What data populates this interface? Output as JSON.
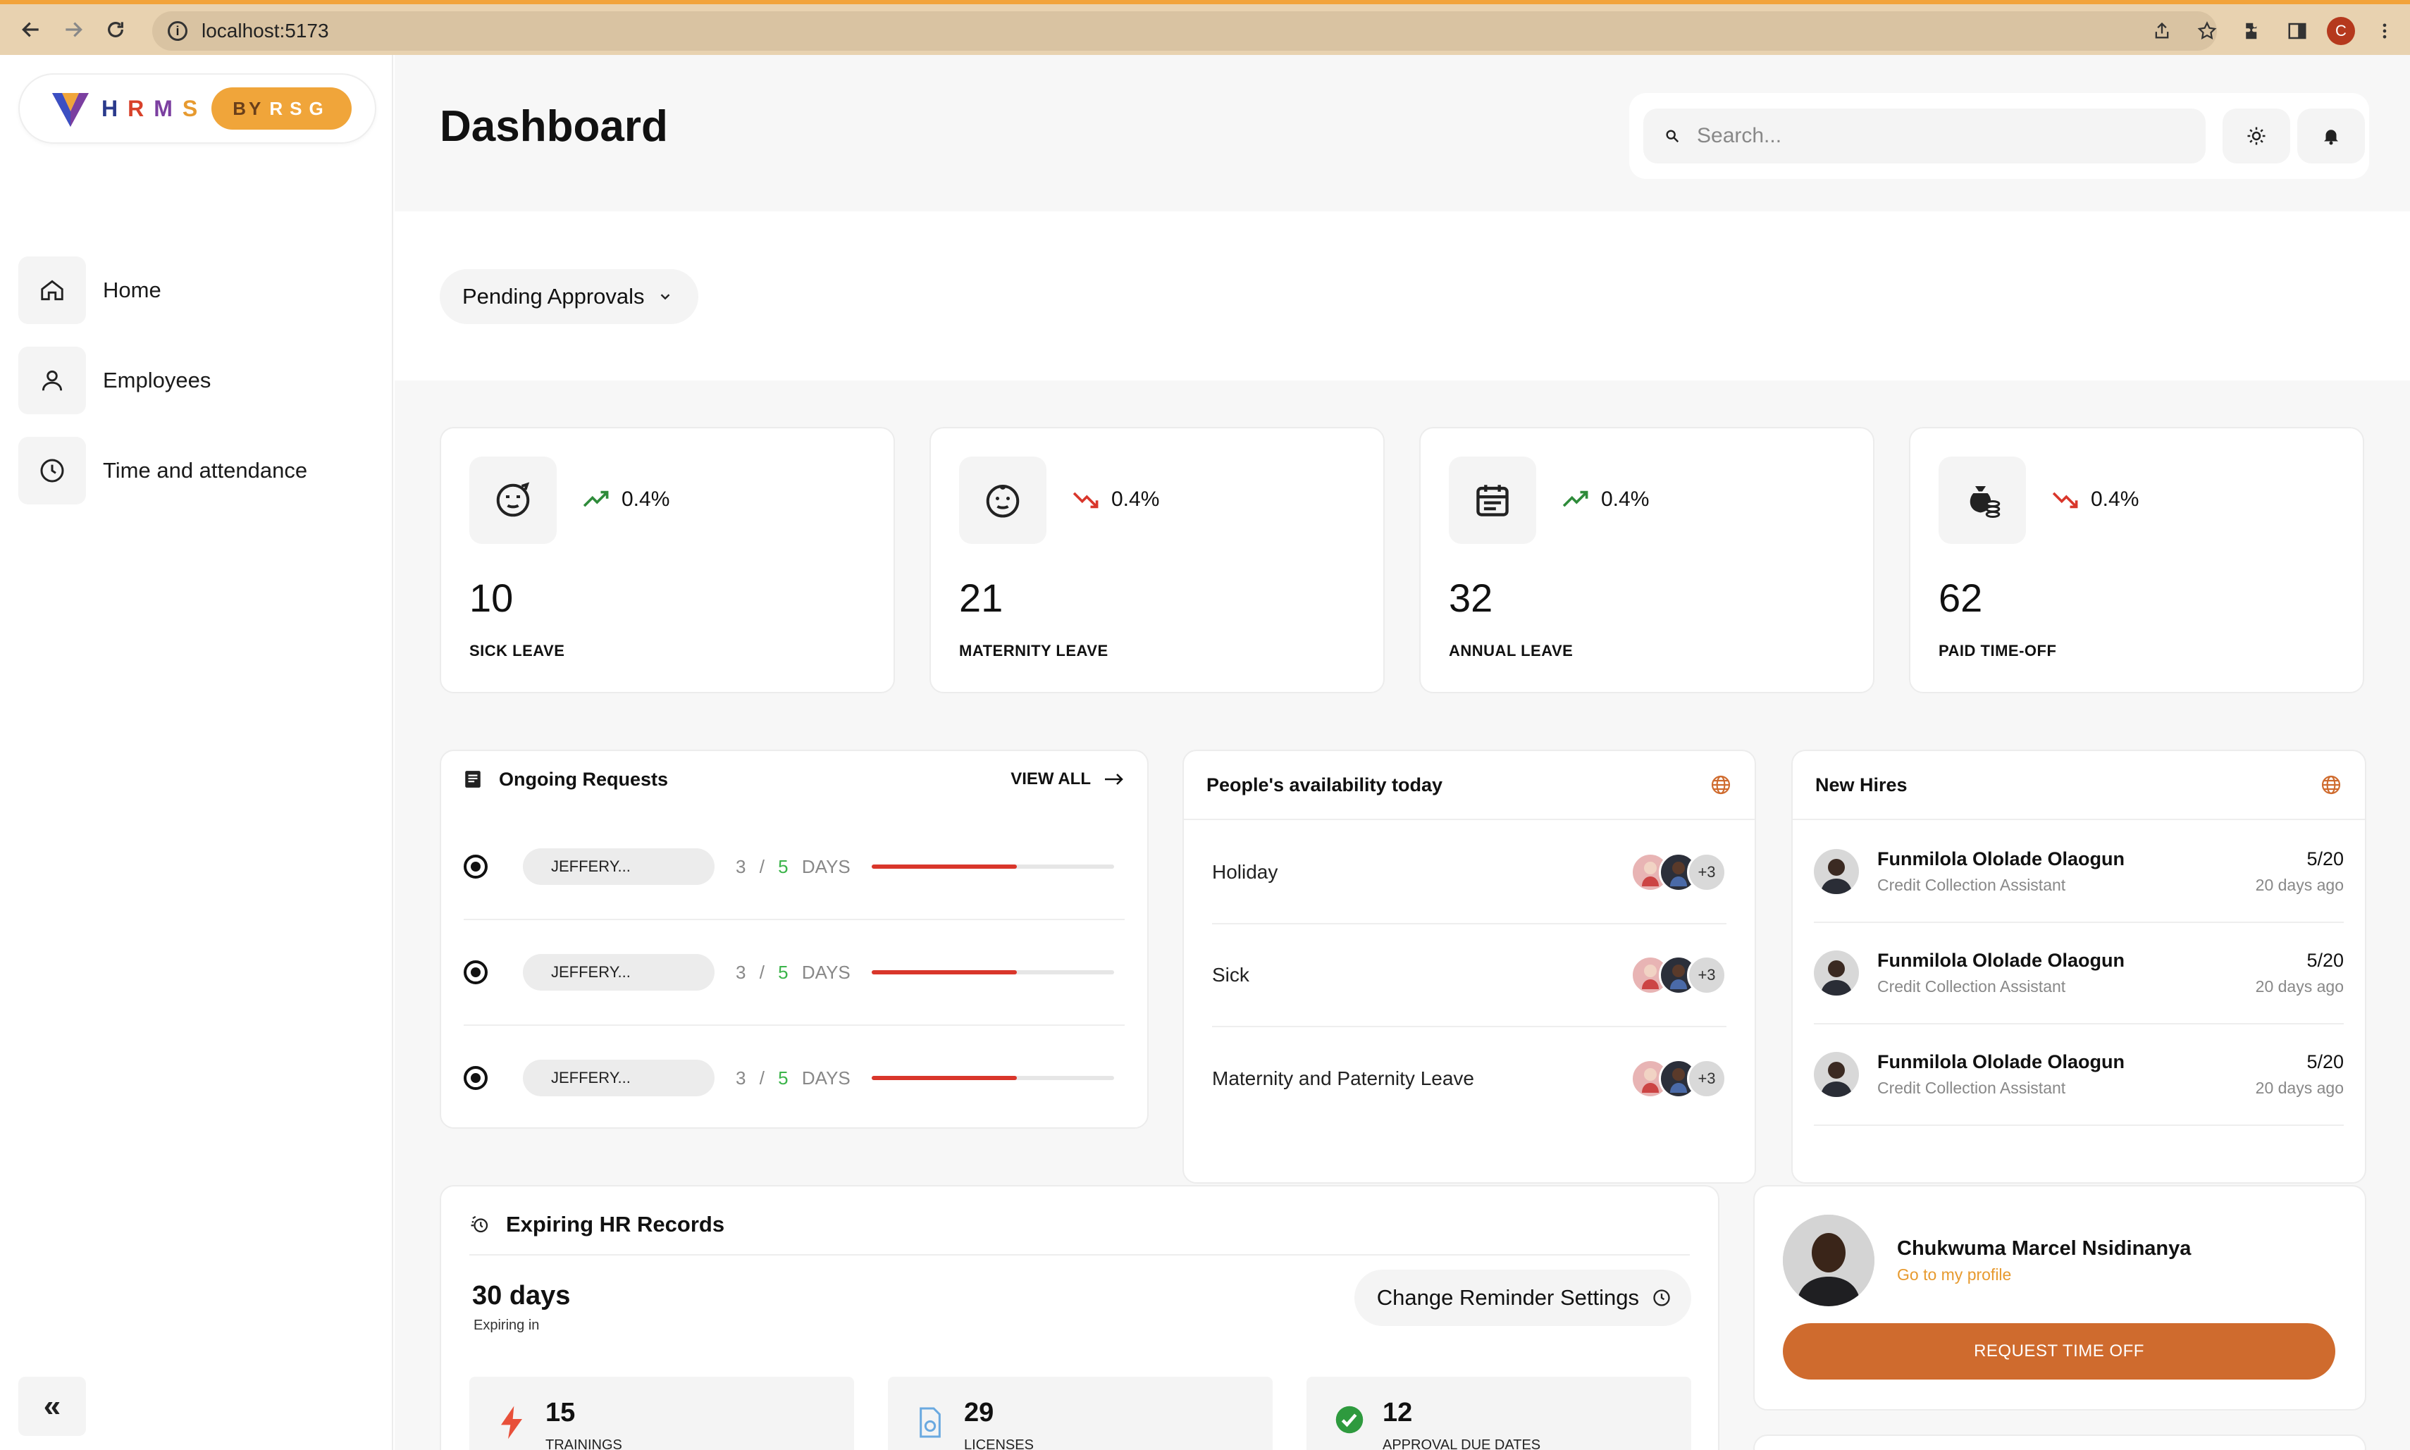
{
  "browser": {
    "url": "localhost:5173",
    "profile_initial": "C"
  },
  "brand": {
    "letters": [
      "H",
      "R",
      "M",
      "S"
    ],
    "by": "BY",
    "org": "RSG"
  },
  "sidebar": {
    "items": [
      {
        "label": "Home",
        "icon": "home-icon"
      },
      {
        "label": "Employees",
        "icon": "user-icon"
      },
      {
        "label": "Time and attendance",
        "icon": "clock-icon"
      }
    ],
    "collapse_label": "«"
  },
  "header": {
    "title": "Dashboard",
    "search_placeholder": "Search..."
  },
  "approvals": {
    "label": "Pending Approvals"
  },
  "stats": [
    {
      "label": "SICK LEAVE",
      "value": "10",
      "change": "0.4%",
      "direction": "up",
      "icon": "sick-face-icon"
    },
    {
      "label": "MATERNITY LEAVE",
      "value": "21",
      "change": "0.4%",
      "direction": "down",
      "icon": "baby-face-icon"
    },
    {
      "label": "ANNUAL LEAVE",
      "value": "32",
      "change": "0.4%",
      "direction": "up",
      "icon": "calendar-icon"
    },
    {
      "label": "PAID TIME-OFF",
      "value": "62",
      "change": "0.4%",
      "direction": "down",
      "icon": "money-bag-icon"
    }
  ],
  "colors": {
    "trend_up": "#2e8b3a",
    "trend_down": "#d9362b",
    "accent": "#cf6b2e",
    "link": "#e79a2f"
  },
  "ongoing_requests": {
    "title": "Ongoing Requests",
    "view_all": "VIEW ALL",
    "rows": [
      {
        "name": "JEFFERY...",
        "used": "3",
        "sep": "/",
        "total": "5",
        "unit": "DAYS",
        "progress": 0.6
      },
      {
        "name": "JEFFERY...",
        "used": "3",
        "sep": "/",
        "total": "5",
        "unit": "DAYS",
        "progress": 0.6
      },
      {
        "name": "JEFFERY...",
        "used": "3",
        "sep": "/",
        "total": "5",
        "unit": "DAYS",
        "progress": 0.6
      }
    ]
  },
  "availability": {
    "title": "People's availability today",
    "more": "+3",
    "rows": [
      {
        "label": "Holiday"
      },
      {
        "label": "Sick"
      },
      {
        "label": "Maternity and Paternity Leave"
      }
    ]
  },
  "new_hires": {
    "title": "New Hires",
    "rows": [
      {
        "name": "Funmilola Ololade Olaogun",
        "role": "Credit Collection Assistant",
        "date": "5/20",
        "ago": "20 days ago"
      },
      {
        "name": "Funmilola Ololade Olaogun",
        "role": "Credit Collection Assistant",
        "date": "5/20",
        "ago": "20 days ago"
      },
      {
        "name": "Funmilola Ololade Olaogun",
        "role": "Credit Collection Assistant",
        "date": "5/20",
        "ago": "20 days ago"
      }
    ]
  },
  "expiring": {
    "title": "Expiring HR Records",
    "days": "30 days",
    "sub": "Expiring in",
    "reminder_button": "Change Reminder Settings",
    "cards": [
      {
        "value": "15",
        "label": "TRAININGS",
        "icon": "lightning-icon"
      },
      {
        "value": "29",
        "label": "LICENSES",
        "icon": "license-icon"
      },
      {
        "value": "12",
        "label": "APPROVAL DUE DATES",
        "icon": "check-circle-icon"
      }
    ]
  },
  "profile": {
    "name": "Chukwuma Marcel Nsidinanya",
    "link": "Go to my profile",
    "button": "REQUEST TIME OFF"
  }
}
